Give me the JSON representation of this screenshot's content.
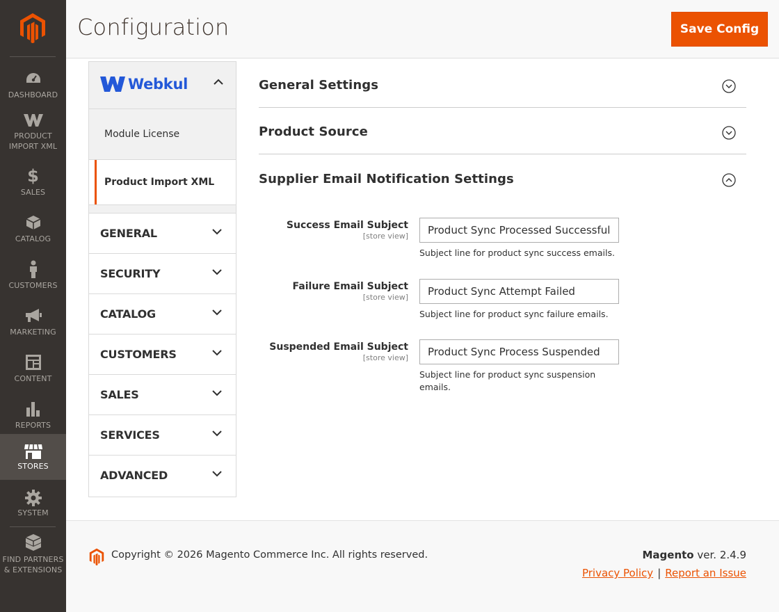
{
  "nav": {
    "items": [
      {
        "label": "Dashboard",
        "icon": "dashboard-icon"
      },
      {
        "label": "Product Import XML",
        "icon": "webkul-icon"
      },
      {
        "label": "Sales",
        "icon": "dollar-icon"
      },
      {
        "label": "Catalog",
        "icon": "box-icon"
      },
      {
        "label": "Customers",
        "icon": "person-icon"
      },
      {
        "label": "Marketing",
        "icon": "megaphone-icon"
      },
      {
        "label": "Content",
        "icon": "layout-icon"
      },
      {
        "label": "Reports",
        "icon": "bar-chart-icon"
      },
      {
        "label": "Stores",
        "icon": "store-icon"
      },
      {
        "label": "System",
        "icon": "gear-icon"
      },
      {
        "label": "Find Partners & Extensions",
        "icon": "blocks-icon"
      }
    ],
    "active": "Stores",
    "accent_color": "#eb5202"
  },
  "header": {
    "title": "Configuration",
    "save_label": "Save Config"
  },
  "tabs": {
    "group_title": "Webkul",
    "sub_items": [
      {
        "label": "Module License"
      },
      {
        "label": "Product Import XML"
      }
    ],
    "sections": [
      {
        "label": "GENERAL"
      },
      {
        "label": "SECURITY"
      },
      {
        "label": "CATALOG"
      },
      {
        "label": "CUSTOMERS"
      },
      {
        "label": "SALES"
      },
      {
        "label": "SERVICES"
      },
      {
        "label": "ADVANCED"
      }
    ]
  },
  "main": {
    "sections": [
      {
        "title": "General Settings",
        "state": "collapsed"
      },
      {
        "title": "Product Source",
        "state": "collapsed"
      },
      {
        "title": "Supplier Email Notification Settings",
        "state": "expanded"
      }
    ],
    "fields": [
      {
        "label": "Success Email Subject",
        "scope": "[store view]",
        "value": "Product Sync Processed Successfully",
        "note": "Subject line for product sync success emails."
      },
      {
        "label": "Failure Email Subject",
        "scope": "[store view]",
        "value": "Product Sync Attempt Failed",
        "note": "Subject line for product sync failure emails."
      },
      {
        "label": "Suspended Email Subject",
        "scope": "[store view]",
        "value": "Product Sync Process Suspended",
        "note": "Subject line for product sync suspension emails."
      }
    ]
  },
  "footer": {
    "copyright": "Copyright © 2026 Magento Commerce Inc. All rights reserved.",
    "brand": "Magento",
    "version": "ver. 2.4.9",
    "privacy_link": "Privacy Policy",
    "separator": "|",
    "report_link": "Report an Issue"
  }
}
